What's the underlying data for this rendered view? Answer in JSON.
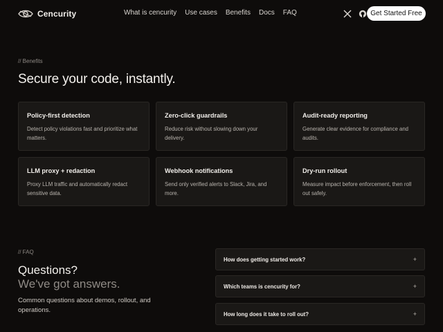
{
  "brand": {
    "name": "Cencurity",
    "logo_icon": "eye-logo-icon"
  },
  "nav": {
    "items": [
      "What is cencurity",
      "Use cases",
      "Benefits",
      "Docs",
      "FAQ"
    ]
  },
  "header_icons": [
    "x-icon",
    "github-icon"
  ],
  "cta": {
    "label": "Get Started Free"
  },
  "benefits": {
    "eyebrow": "// Benefits",
    "title": "Secure your code, instantly.",
    "cards": [
      {
        "title": "Policy-first detection",
        "desc": "Detect policy violations fast and prioritize what matters."
      },
      {
        "title": "Zero-click guardrails",
        "desc": "Reduce risk without slowing down your delivery."
      },
      {
        "title": "Audit-ready reporting",
        "desc": "Generate clear evidence for compliance and audits."
      },
      {
        "title": "LLM proxy + redaction",
        "desc": "Proxy LLM traffic and automatically redact sensitive data."
      },
      {
        "title": "Webhook notifications",
        "desc": "Send only verified alerts to Slack, Jira, and more."
      },
      {
        "title": "Dry-run rollout",
        "desc": "Measure impact before enforcement, then roll out safely."
      }
    ]
  },
  "faq": {
    "eyebrow": "// FAQ",
    "title_line1": "Questions?",
    "title_line2": "We've got answers.",
    "desc": "Common questions about demos, rollout, and operations.",
    "items": [
      {
        "question": "How does getting started work?",
        "icon": "+"
      },
      {
        "question": "Which teams is cencurity for?",
        "icon": "+"
      },
      {
        "question": "How long does it take to roll out?",
        "icon": "+"
      }
    ]
  },
  "colors": {
    "background": "#0e0c0b",
    "card": "#1a1816",
    "accent_button": "#ffffff"
  }
}
